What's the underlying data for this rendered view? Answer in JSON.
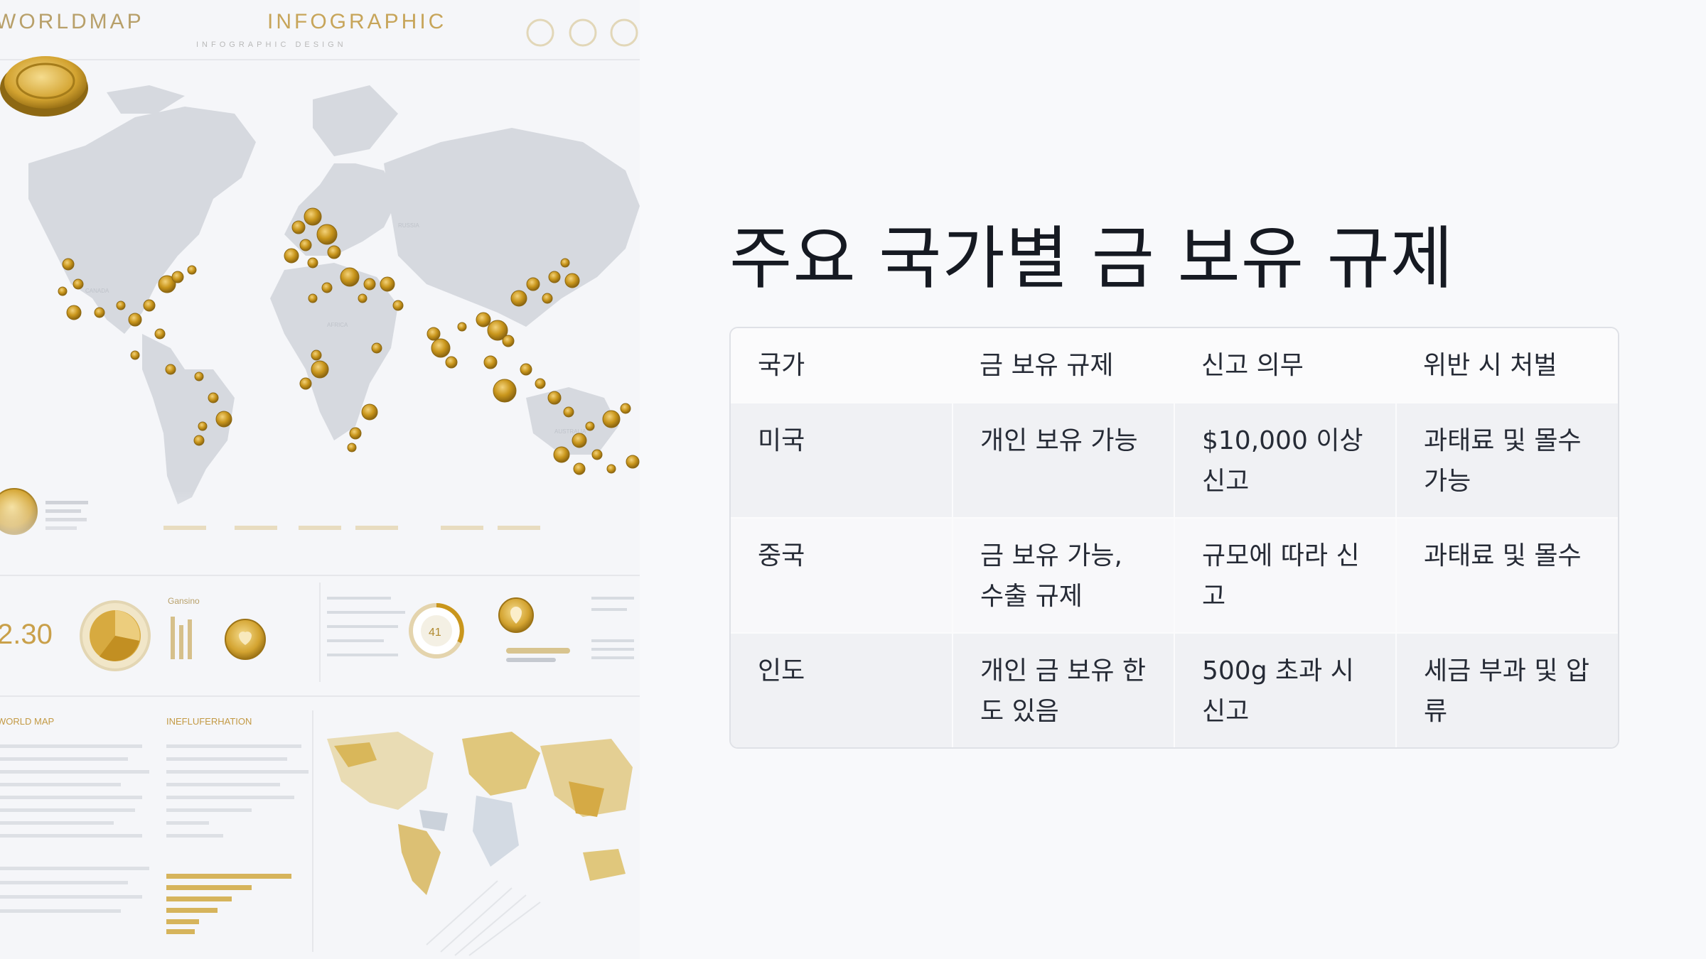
{
  "image": {
    "header_left": "WORLDMAP",
    "header_center": "INFOGRAPHIC",
    "header_sub": "INFOGRAPHIC DESIGN",
    "panel_number": "2.30",
    "panel_label_genshin": "Gansino",
    "panel_gauge": "41",
    "bottom_left_label": "WORLD MAP",
    "bottom_center_label": "INEFLUFERHATION",
    "accent_gold": "#c99a1e",
    "map_gray": "#d5d8de"
  },
  "slide": {
    "title": "주요 국가별 금 보유 규제"
  },
  "table": {
    "headers": [
      "국가",
      "금 보유 규제",
      "신고 의무",
      "위반 시 처벌"
    ],
    "rows": [
      [
        "미국",
        "개인 보유 가능",
        "$10,000 이상 신고",
        "과태료 및 몰수 가능"
      ],
      [
        "중국",
        "금 보유 가능, 수출 규제",
        "규모에 따라 신고",
        "과태료 및 몰수"
      ],
      [
        "인도",
        "개인 금 보유 한도 있음",
        "500g 초과 시 신고",
        "세금 부과 및 압류"
      ]
    ]
  }
}
